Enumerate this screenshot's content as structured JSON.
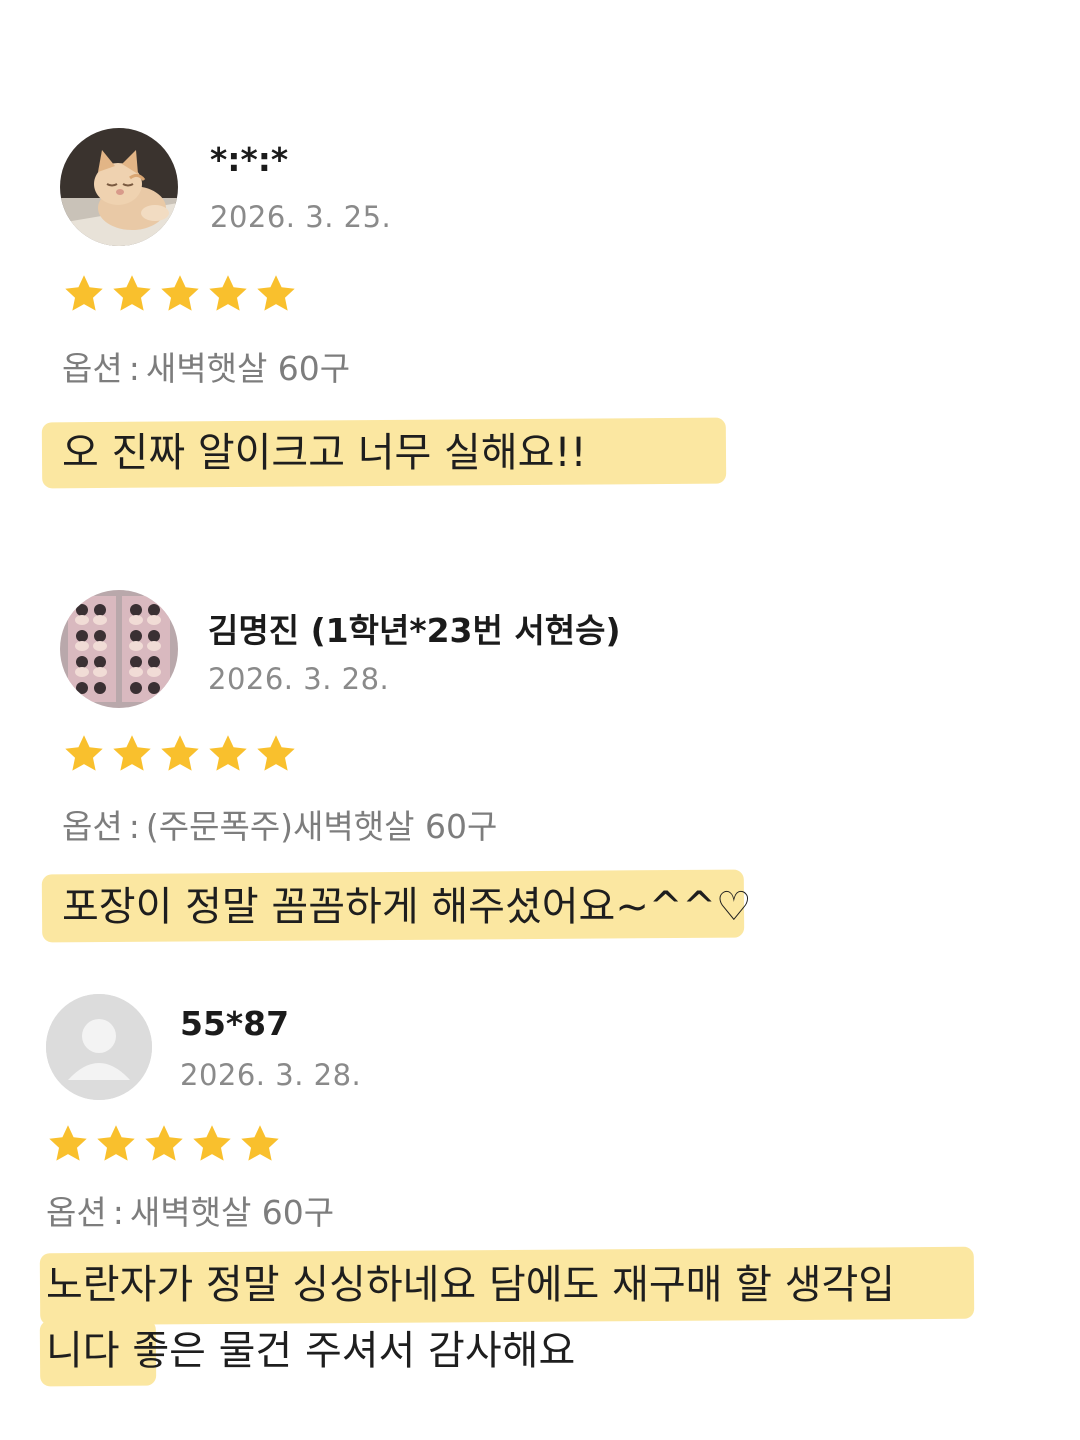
{
  "reviews": [
    {
      "avatar": "cat-photo",
      "name": "*:*:*",
      "date": "2026. 3. 25.",
      "rating": 5,
      "option_label": "옵션",
      "option_sep": ":",
      "option_value": "새벽햇살 60구",
      "text_lines": [
        "오 진짜 알이크고 너무 실해요!!"
      ]
    },
    {
      "avatar": "group-photo",
      "name": "김명진 (1학년*23번 서현승)",
      "date": "2026. 3. 28.",
      "rating": 5,
      "option_label": "옵션",
      "option_sep": ":",
      "option_value": "(주문폭주)새벽햇살 60구",
      "text_lines": [
        "포장이 정말 꼼꼼하게 해주셨어요~^^♡"
      ]
    },
    {
      "avatar": "default-user",
      "name": "55*87",
      "date": "2026. 3. 28.",
      "rating": 5,
      "option_label": "옵션",
      "option_sep": ":",
      "option_value": "새벽햇살 60구",
      "text_lines": [
        "노란자가 정말 싱싱하네요 담에도 재구매 할 생각입",
        "니다 좋은 물건 주셔서 감사해요"
      ]
    }
  ],
  "colors": {
    "star": "#f9c02d",
    "highlight": "#fbe7a1",
    "muted_text": "#8a8a8a"
  },
  "icons": [
    "star-icon",
    "user-silhouette-icon"
  ]
}
